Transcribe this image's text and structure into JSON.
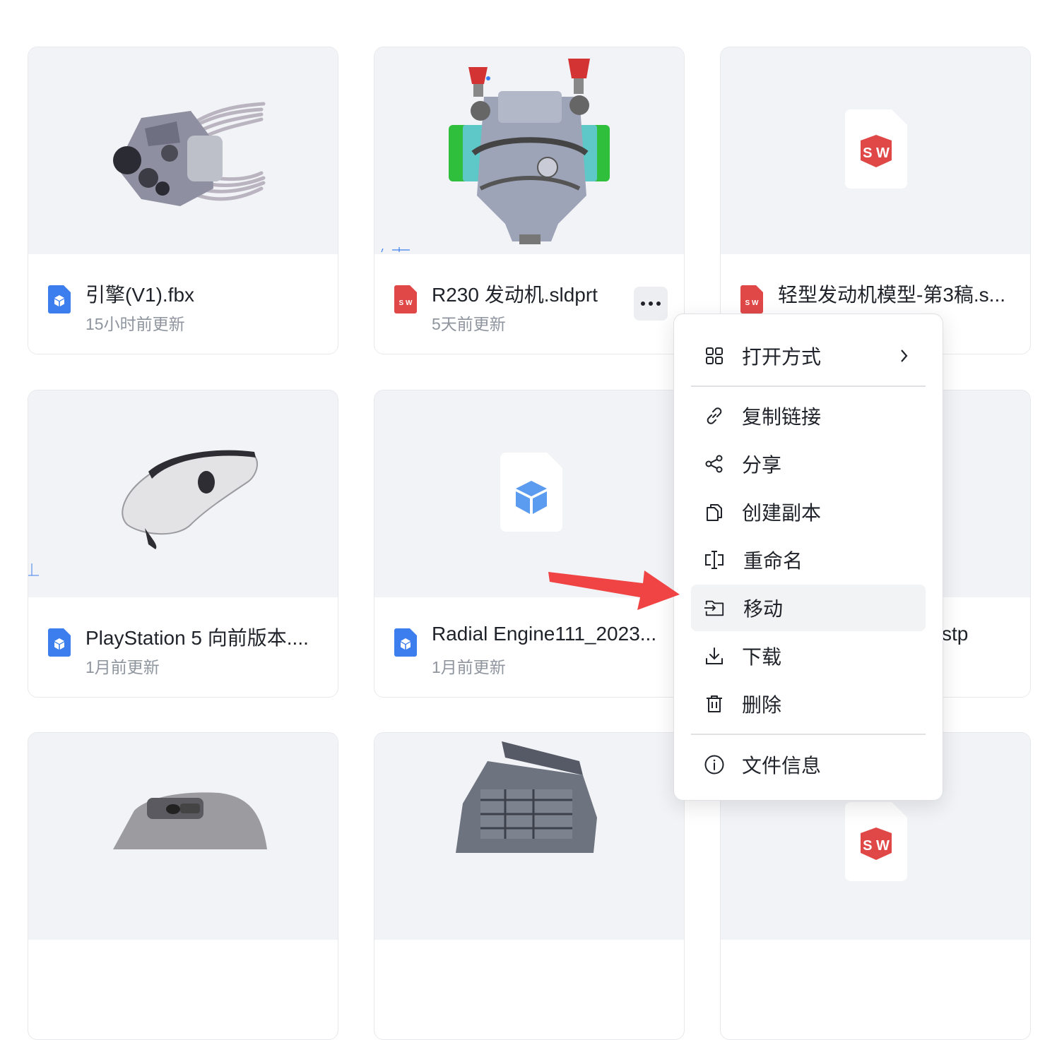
{
  "files": [
    {
      "name": "引擎(V1).fbx",
      "time": "15小时前更新",
      "type_icon": "3d-model-icon"
    },
    {
      "name": "R230 发动机.sldprt",
      "time": "5天前更新",
      "type_icon": "solidworks-icon"
    },
    {
      "name": "轻型发动机模型-第3稿.s...",
      "time": "",
      "type_icon": "solidworks-icon"
    },
    {
      "name": "PlayStation 5 向前版本....",
      "time": "1月前更新",
      "type_icon": "3d-model-icon"
    },
    {
      "name": "Radial Engine111_2023...",
      "time": "1月前更新",
      "type_icon": "3d-model-icon"
    },
    {
      "name": "stp",
      "time": "",
      "type_icon": "3d-model-icon"
    }
  ],
  "card_placeholder": {
    "sw_text": "S W"
  },
  "context_menu": {
    "items": [
      {
        "label": "打开方式",
        "icon": "grid-icon",
        "has_submenu": true
      },
      {
        "label": "复制链接",
        "icon": "link-icon"
      },
      {
        "label": "分享",
        "icon": "share-icon"
      },
      {
        "label": "创建副本",
        "icon": "copy-icon"
      },
      {
        "label": "重命名",
        "icon": "rename-icon"
      },
      {
        "label": "移动",
        "icon": "move-icon",
        "highlighted": true
      },
      {
        "label": "下载",
        "icon": "download-icon"
      },
      {
        "label": "删除",
        "icon": "trash-icon"
      },
      {
        "label": "文件信息",
        "icon": "info-icon"
      }
    ]
  },
  "colors": {
    "accent_blue": "#3d7eef",
    "solidworks_red": "#e04848",
    "arrow_red": "#f04444",
    "thumb_bg": "#f2f3f6"
  }
}
